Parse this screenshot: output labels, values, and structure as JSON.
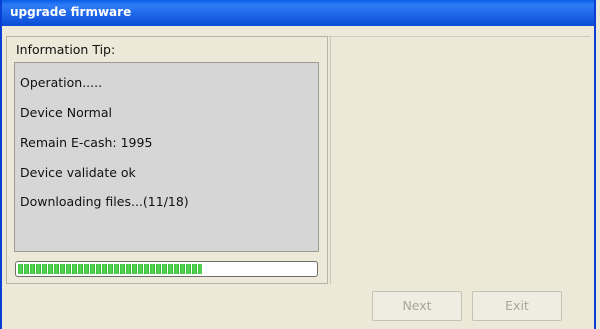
{
  "window": {
    "title": "upgrade firmware"
  },
  "info": {
    "label": "Information Tip:",
    "lines": [
      "Operation.....",
      "Device Normal",
      "Remain E-cash: 1995",
      "Device validate ok",
      "Downloading files...(11/18)"
    ]
  },
  "progress": {
    "fraction": 0.62
  },
  "buttons": {
    "next_label": "Next",
    "exit_label": "Exit"
  },
  "colors": {
    "titlebar": "#0a5ee8",
    "progress_green": "#3ac43a",
    "window_bg": "#ece9d8"
  }
}
